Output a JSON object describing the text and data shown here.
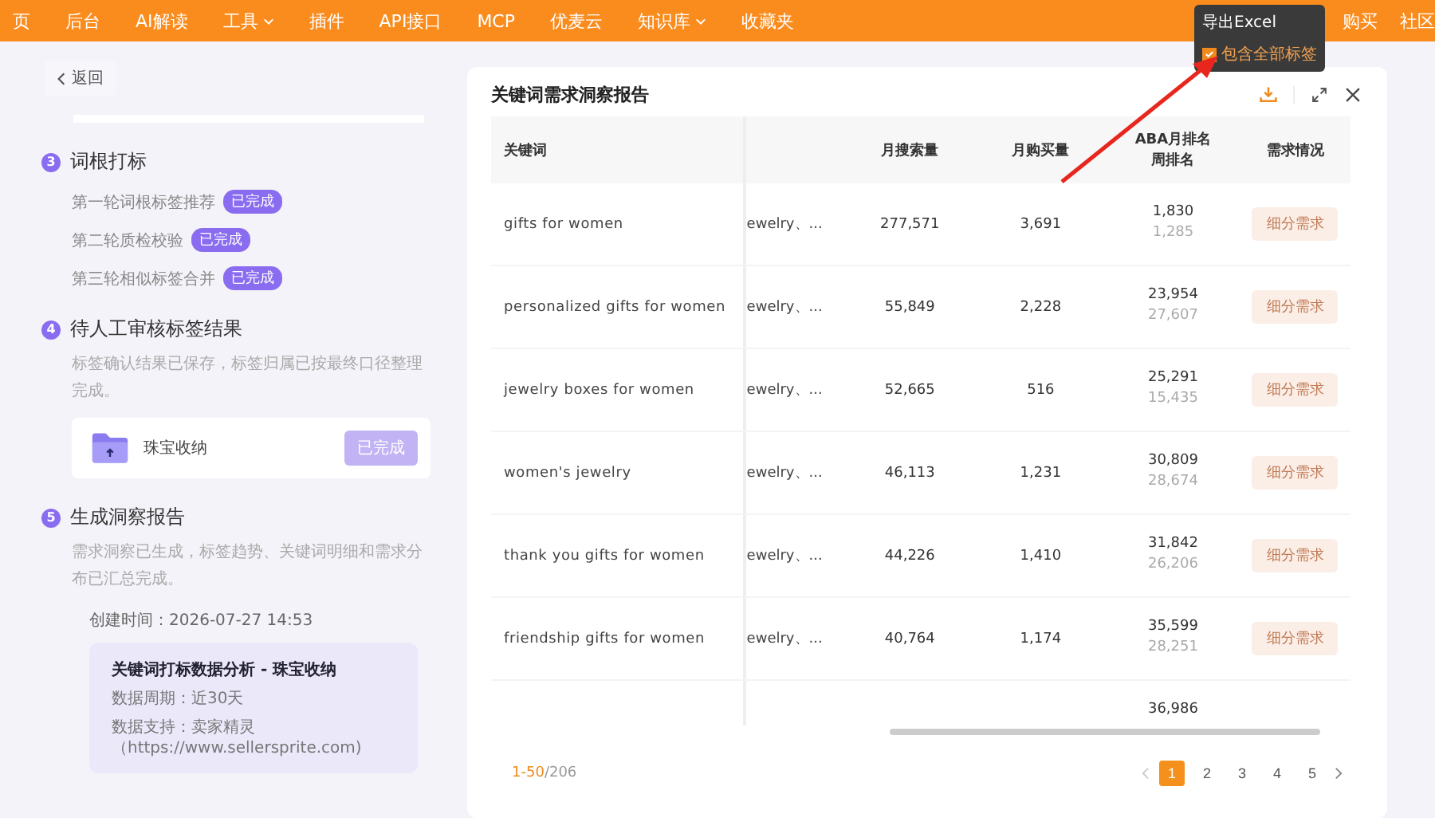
{
  "nav": {
    "items": [
      {
        "label": "页",
        "dropdown": false
      },
      {
        "label": "后台",
        "dropdown": false
      },
      {
        "label": "AI解读",
        "dropdown": false
      },
      {
        "label": "工具",
        "dropdown": true
      },
      {
        "label": "插件",
        "dropdown": false
      },
      {
        "label": "API接口",
        "dropdown": false
      },
      {
        "label": "MCP",
        "dropdown": false
      },
      {
        "label": "优麦云",
        "dropdown": false
      },
      {
        "label": "知识库",
        "dropdown": true
      },
      {
        "label": "收藏夹",
        "dropdown": false
      }
    ],
    "right_items": [
      "购买",
      "社区"
    ]
  },
  "tooltip": {
    "title": "导出Excel",
    "option": {
      "label": "包含全部标签",
      "checked": true
    }
  },
  "sidebar": {
    "back": "返回",
    "steps": [
      {
        "number": "3",
        "title": "词根打标",
        "subtasks": [
          {
            "label": "第一轮词根标签推荐",
            "status": "已完成"
          },
          {
            "label": "第二轮质检校验",
            "status": "已完成"
          },
          {
            "label": "第三轮相似标签合并",
            "status": "已完成"
          }
        ]
      },
      {
        "number": "4",
        "title": "待人工审核标签结果",
        "description": "标签确认结果已保存，标签归属已按最终口径整理完成。",
        "file": {
          "name": "珠宝收纳",
          "button": "已完成"
        }
      },
      {
        "number": "5",
        "title": "生成洞察报告",
        "description": "需求洞察已生成，标签趋势、关键词明细和需求分布已汇总完成。",
        "created": "创建时间：2026-07-27 14:53",
        "report": {
          "title": "关键词打标数据分析 - 珠宝收纳",
          "period": "数据周期：近30天",
          "source": "数据支持：卖家精灵（https://www.sellersprite.com)"
        }
      }
    ]
  },
  "panel": {
    "title": "关键词需求洞察报告",
    "table": {
      "columns": [
        "关键词",
        "月搜索量",
        "月购买量",
        "ABA月排名",
        "周排名",
        "需求情况"
      ],
      "rows": [
        {
          "keyword": "gifts for women",
          "category": "ewelry、...",
          "search": "277,571",
          "purchase": "3,691",
          "aba": "1,830",
          "week": "1,285",
          "demand": "细分需求"
        },
        {
          "keyword": "personalized gifts for women",
          "category": "ewelry、...",
          "search": "55,849",
          "purchase": "2,228",
          "aba": "23,954",
          "week": "27,607",
          "demand": "细分需求"
        },
        {
          "keyword": "jewelry boxes for women",
          "category": "ewelry、...",
          "search": "52,665",
          "purchase": "516",
          "aba": "25,291",
          "week": "15,435",
          "demand": "细分需求"
        },
        {
          "keyword": "women's jewelry",
          "category": "ewelry、...",
          "search": "46,113",
          "purchase": "1,231",
          "aba": "30,809",
          "week": "28,674",
          "demand": "细分需求"
        },
        {
          "keyword": "thank you gifts for women",
          "category": "ewelry、...",
          "search": "44,226",
          "purchase": "1,410",
          "aba": "31,842",
          "week": "26,206",
          "demand": "细分需求"
        },
        {
          "keyword": "friendship gifts for women",
          "category": "ewelry、...",
          "search": "40,764",
          "purchase": "1,174",
          "aba": "35,599",
          "week": "28,251",
          "demand": "细分需求"
        },
        {
          "aba": "36,986"
        }
      ]
    },
    "pagination": {
      "range": "1-50",
      "total": "/206",
      "pages": [
        {
          "label": "1",
          "selected": true
        },
        {
          "label": "2",
          "selected": false
        },
        {
          "label": "3",
          "selected": false
        },
        {
          "label": "4",
          "selected": false
        },
        {
          "label": "5",
          "selected": false
        }
      ]
    }
  }
}
